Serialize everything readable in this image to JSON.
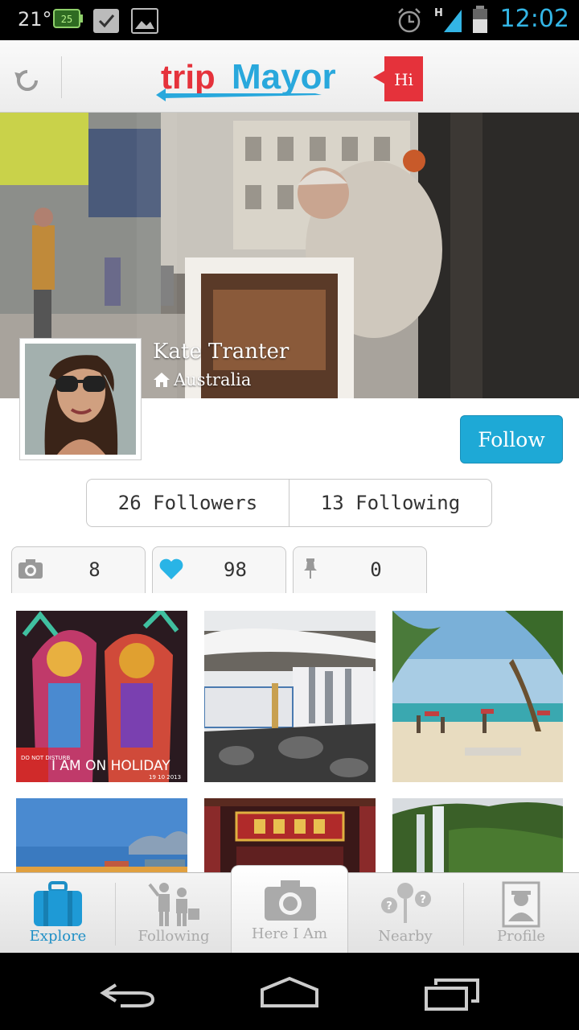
{
  "status_bar": {
    "temperature": "21°",
    "battery_label": "25",
    "network": "H",
    "time": "12:02"
  },
  "header": {
    "logo_text_part1": "trip",
    "logo_text_part2": "Mayor",
    "logo_badge": "Hi",
    "refresh_icon": "refresh-icon"
  },
  "profile": {
    "name": "Kate Tranter",
    "location": "Australia",
    "follow_label": "Follow",
    "followers": "26 Followers",
    "following": "13 Following"
  },
  "counters": [
    {
      "icon": "camera-icon",
      "value": "8"
    },
    {
      "icon": "heart-icon",
      "value": "98"
    },
    {
      "icon": "pin-icon",
      "value": "0"
    }
  ],
  "photos": [
    {
      "caption": "I AM ON HOLIDAY",
      "sub": "DO NOT DISTURB",
      "date": "19 10 2013"
    },
    {
      "caption": ""
    },
    {
      "caption": ""
    },
    {
      "caption": ""
    },
    {
      "caption": ""
    },
    {
      "caption": ""
    }
  ],
  "tabs": [
    {
      "label": "Explore",
      "icon": "suitcase-icon",
      "active": true
    },
    {
      "label": "Following",
      "icon": "people-icon",
      "active": false
    },
    {
      "label": "Here I Am",
      "icon": "camera-icon",
      "active": false
    },
    {
      "label": "Nearby",
      "icon": "nearby-icon",
      "active": false
    },
    {
      "label": "Profile",
      "icon": "profile-icon",
      "active": false
    }
  ],
  "colors": {
    "accent": "#1ea9d6",
    "brand_red": "#e5323b",
    "status_blue": "#33b5e5"
  }
}
